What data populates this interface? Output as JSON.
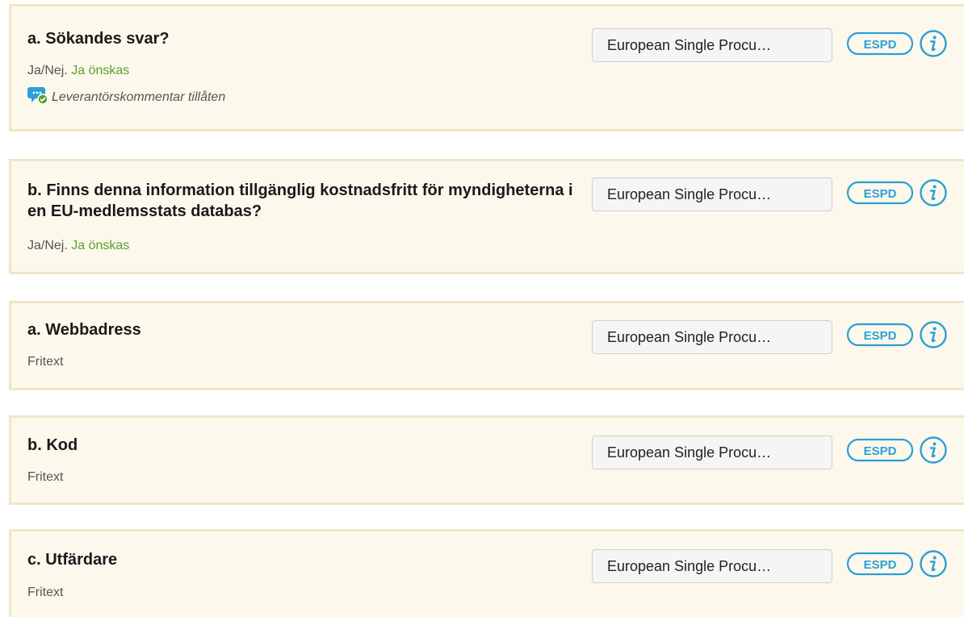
{
  "questions": [
    {
      "title": "a. Sökandes svar?",
      "type_prefix": "Ja/Nej.",
      "type_value": "Ja önskas",
      "comment": "Leverantörskommentar tillåten",
      "select_value": "European Single Procu…",
      "espd_label": "ESPD"
    },
    {
      "title": "b. Finns denna information tillgänglig kostnadsfritt för myndigheterna i en EU-medlemsstats databas?",
      "type_prefix": "Ja/Nej.",
      "type_value": "Ja önskas",
      "select_value": "European Single Procu…",
      "espd_label": "ESPD"
    },
    {
      "title": "a. Webbadress",
      "type_prefix": "Fritext",
      "select_value": "European Single Procu…",
      "espd_label": "ESPD"
    },
    {
      "title": "b. Kod",
      "type_prefix": "Fritext",
      "select_value": "European Single Procu…",
      "espd_label": "ESPD"
    },
    {
      "title": "c. Utfärdare",
      "type_prefix": "Fritext",
      "select_value": "European Single Procu…",
      "espd_label": "ESPD"
    }
  ],
  "icons": {
    "comment": "comment-allowed-icon",
    "info": "info-icon",
    "espd": "espd-badge"
  },
  "colors": {
    "card_bg": "#fcf8ec",
    "card_border": "#efe6c6",
    "accent_blue": "#2b9fd8",
    "green": "#5aa02c"
  }
}
